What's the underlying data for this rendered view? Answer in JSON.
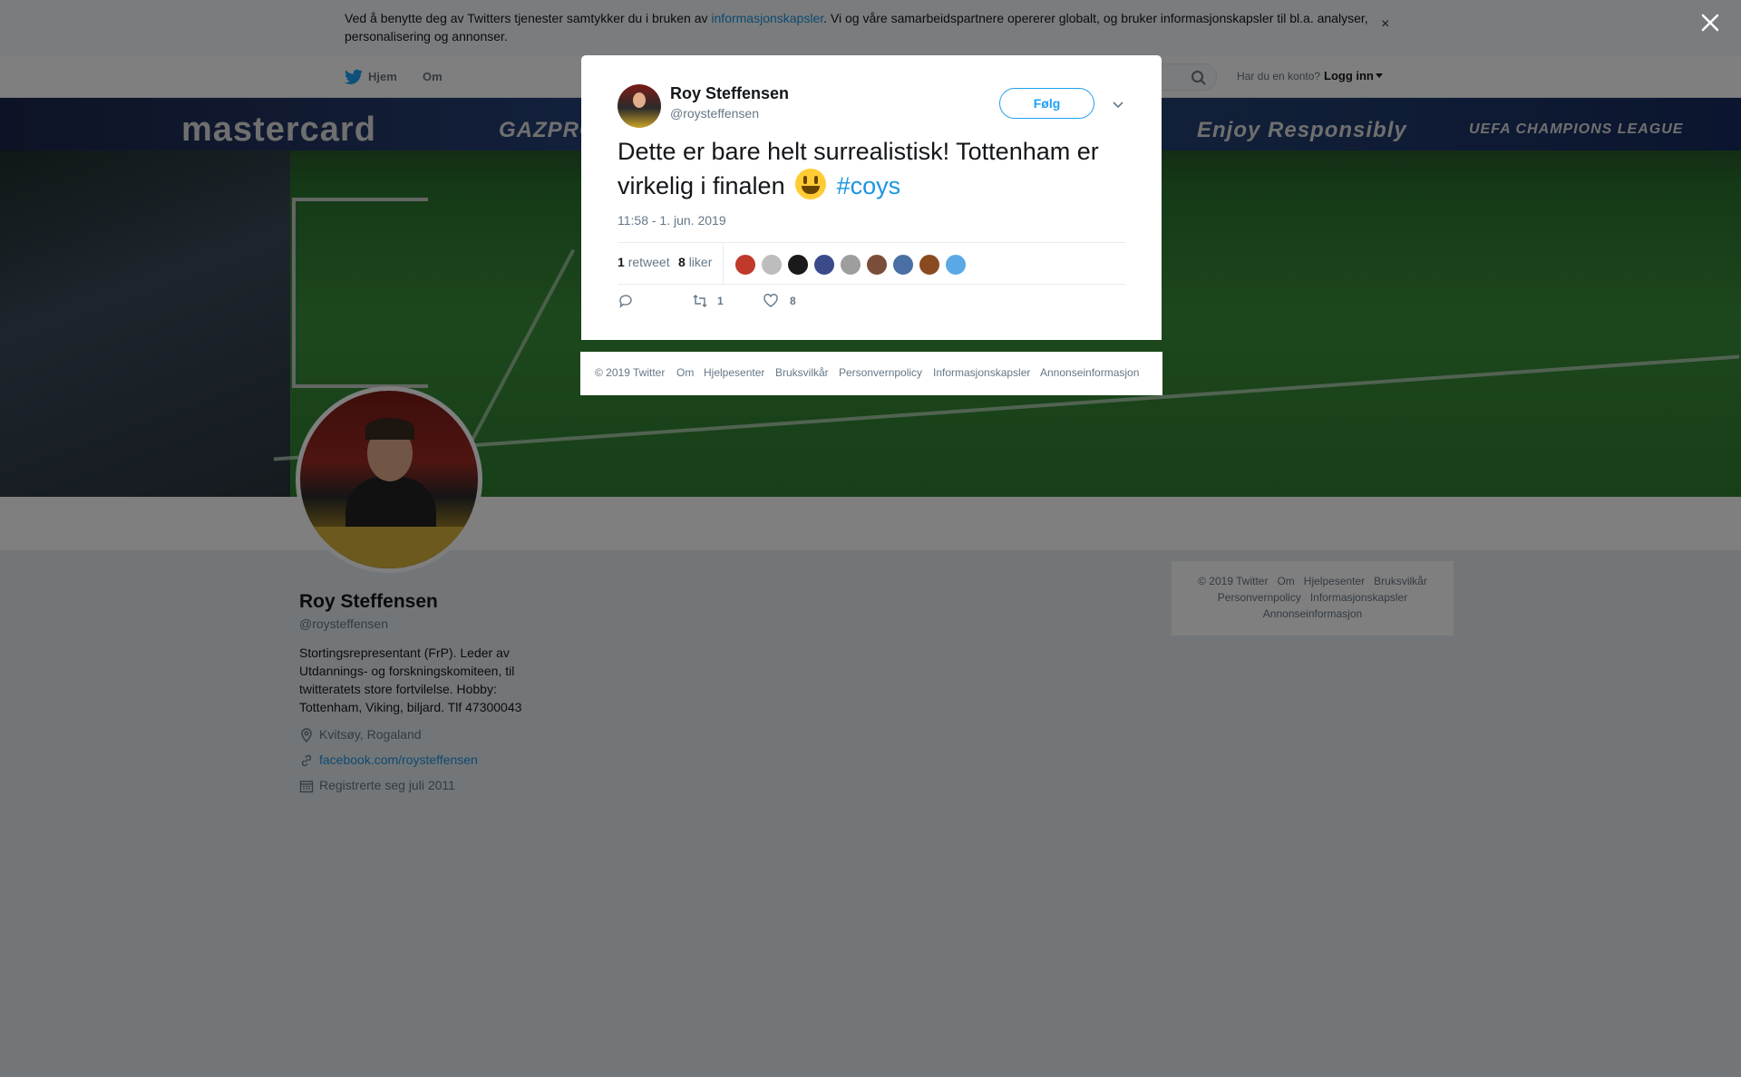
{
  "cookie_banner": {
    "text_before": "Ved å benytte deg av Twitters tjenester samtykker du i bruken av ",
    "link": "informasjonskapsler",
    "text_after": ". Vi og våre samarbeidspartnere opererer globalt, og bruker informasjonskapsler til bl.a. analyser, personalisering og annonser.",
    "close": "×"
  },
  "nav": {
    "home": "Hjem",
    "about": "Om",
    "account_prompt": "Har du en konto?",
    "login": "Logg inn"
  },
  "banner": {
    "ads": [
      "mastercard",
      "GAZPROM",
      "Enjoy Responsibly",
      "UEFA CHAMPIONS LEAGUE"
    ]
  },
  "profile": {
    "name": "Roy Steffensen",
    "handle": "@roysteffensen",
    "bio": "Stortingsrepresentant (FrP). Leder av Utdannings- og forskningskomiteen, til twitteratets store fortvilelse. Hobby: Tottenham, Viking, biljard. Tlf 47300043",
    "location": "Kvitsøy, Rogaland",
    "website": "facebook.com/roysteffensen",
    "joined": "Registrerte seg juli 2011"
  },
  "side_footer": {
    "row1": [
      "© 2019 Twitter",
      "Om",
      "Hjelpesenter",
      "Bruksvilkår"
    ],
    "row2": [
      "Personvernpolicy",
      "Informasjonskapsler"
    ],
    "row3": [
      "Annonseinformasjon"
    ]
  },
  "tweet": {
    "author_name": "Roy Steffensen",
    "author_handle": "@roysteffensen",
    "follow_label": "Følg",
    "text": "Dette er bare helt surrealistisk! Tottenham er virkelig i finalen",
    "hashtag": "#coys",
    "timestamp": "11:58 - 1. jun. 2019",
    "retweets_count": "1",
    "retweets_label": "retweet",
    "likes_count": "8",
    "likes_label": "liker",
    "liker_colors": [
      "#c0392b",
      "#bdbdbd",
      "#1a1a1a",
      "#3a4a8a",
      "#9e9e9e",
      "#7a4e3a",
      "#4a6fa5",
      "#8a4a20",
      "#5aa9e6"
    ],
    "action_retweets": "1",
    "action_likes": "8"
  },
  "modal_footer": [
    "© 2019 Twitter",
    "Om",
    "Hjelpesenter",
    "Bruksvilkår",
    "Personvernpolicy",
    "Informasjonskapsler",
    "Annonseinformasjon"
  ],
  "colors": {
    "twitter_blue": "#1da1f2",
    "link_blue": "#1b95e0",
    "overlay": "rgba(0,0,0,0.5)"
  }
}
